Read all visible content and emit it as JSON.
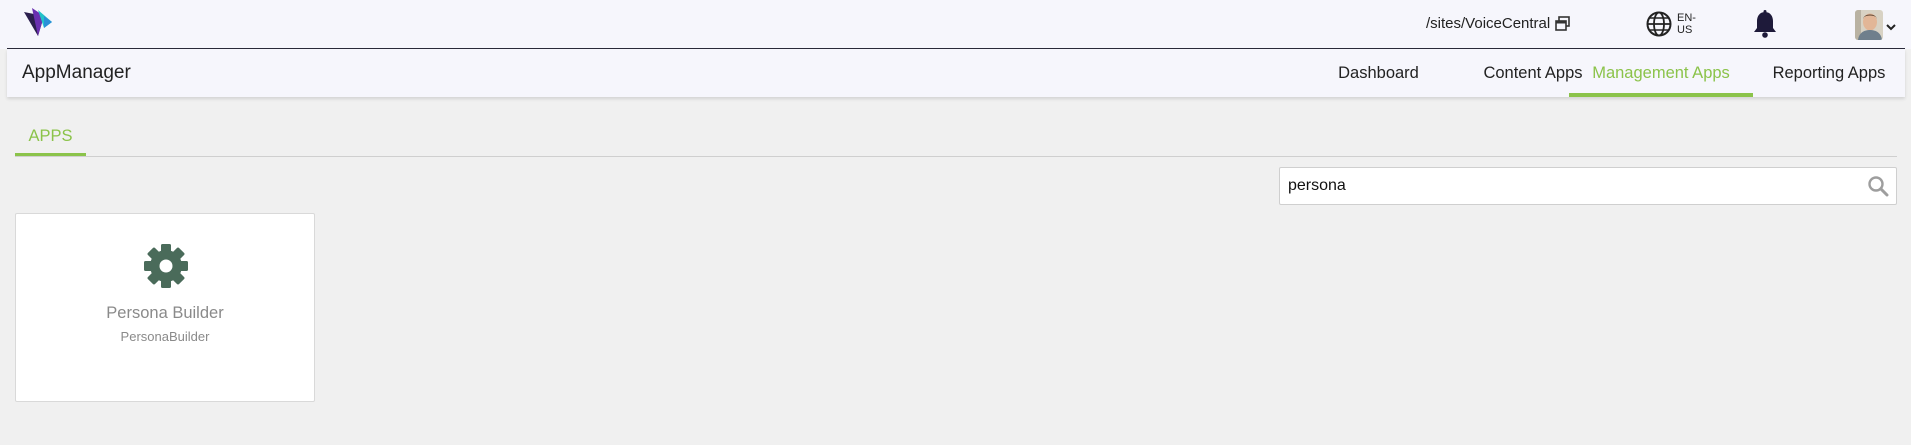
{
  "topbar": {
    "logo_icon": "brand-logo-icon",
    "site_path": "/sites/VoiceCentral",
    "site_switch_icon": "window-switch-icon",
    "language_icon": "globe-icon",
    "language_line1": "EN-",
    "language_line2": "US",
    "notifications_icon": "bell-icon",
    "user_avatar": "user-avatar",
    "user_menu_icon": "chevron-down-icon"
  },
  "subbar": {
    "title": "AppManager",
    "nav": [
      {
        "label": "Dashboard",
        "active": false
      },
      {
        "label": "Content Apps",
        "active": false
      },
      {
        "label": "Management Apps",
        "active": true
      },
      {
        "label": "Reporting Apps",
        "active": false
      }
    ]
  },
  "tabs": {
    "apps_label": "APPS"
  },
  "search": {
    "value": "persona",
    "icon": "search-icon"
  },
  "apps": [
    {
      "name": "Persona Builder",
      "id": "PersonaBuilder",
      "icon": "gear-icon",
      "icon_color": "#4a6b5a"
    }
  ],
  "colors": {
    "accent": "#8bc34a",
    "topbar_bg": "#f6f6fc",
    "page_bg": "#f0f0f0"
  }
}
